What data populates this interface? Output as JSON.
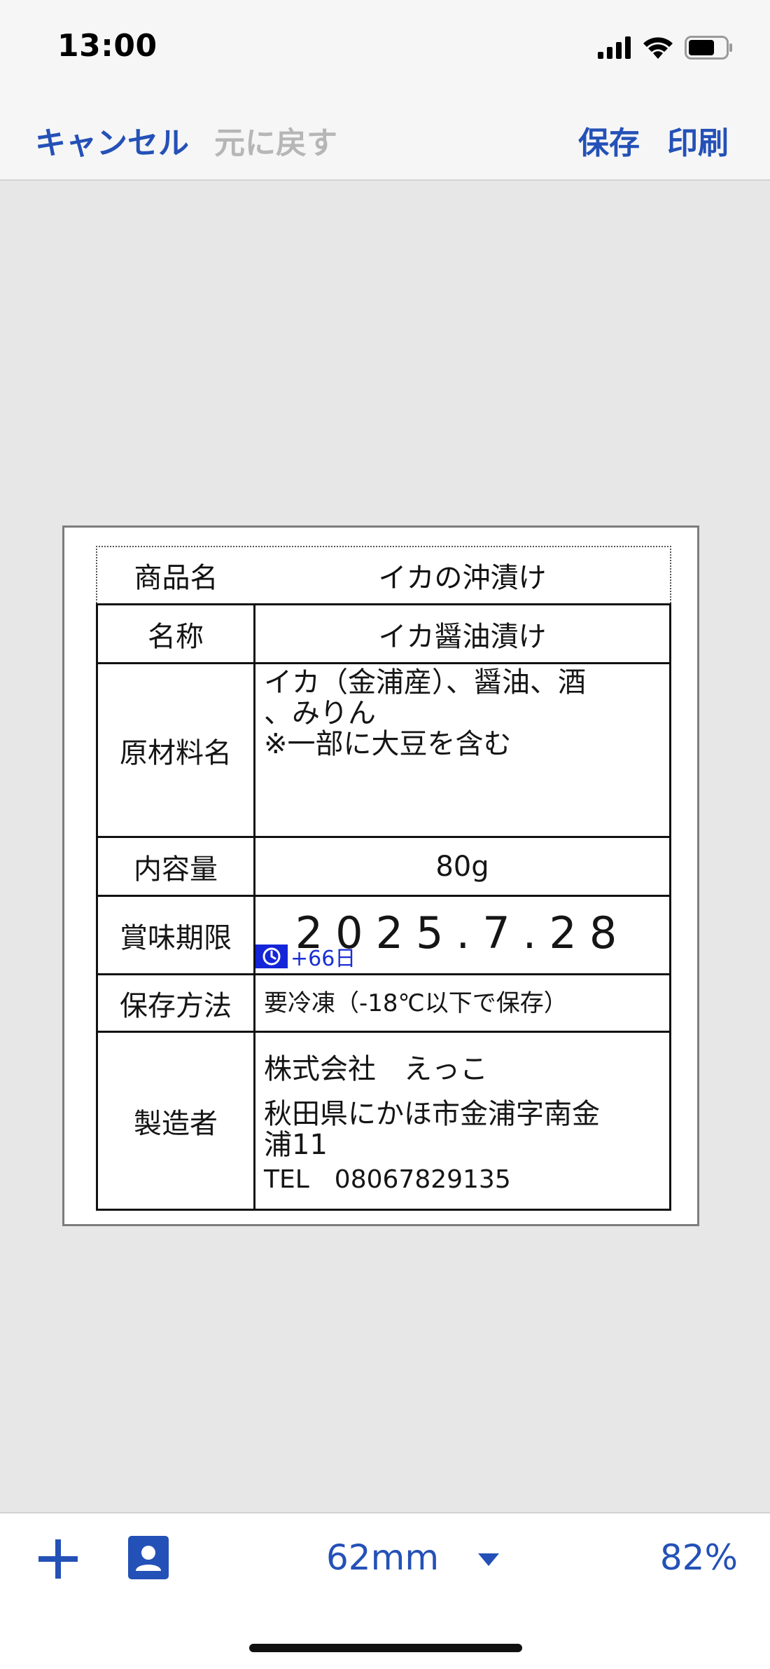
{
  "status_bar": {
    "time": "13:00"
  },
  "nav": {
    "cancel": "キャンセル",
    "undo": "元に戻す",
    "save": "保存",
    "print": "印刷"
  },
  "label": {
    "product_name_label": "商品名",
    "product_name": "イカの沖漬け",
    "rows": {
      "name_label": "名称",
      "name": "イカ醤油漬け",
      "ingredients_label": "原材料名",
      "ingredients_line1": "イカ（金浦産）、醤油、酒",
      "ingredients_line2": "、みりん",
      "ingredients_note": "※一部に大豆を含む",
      "content_label": "内容量",
      "content": "80g",
      "expiry_label": "賞味期限",
      "expiry_date": "2025.7.28",
      "expiry_offset": "+66日",
      "storage_label": "保存方法",
      "storage": "要冷凍（-18℃以下で保存）",
      "maker_label": "製造者",
      "maker_company": "株式会社　えっこ",
      "maker_address_line1": "秋田県にかほ市金浦字南金",
      "maker_address_line2": "浦11",
      "maker_tel": "TEL　08067829135"
    }
  },
  "bottom_bar": {
    "label_size": "62mm",
    "zoom": "82%"
  },
  "colors": {
    "accent": "#2451b7",
    "disabled": "#b6b6b6",
    "date_offset": "#1525d8"
  }
}
